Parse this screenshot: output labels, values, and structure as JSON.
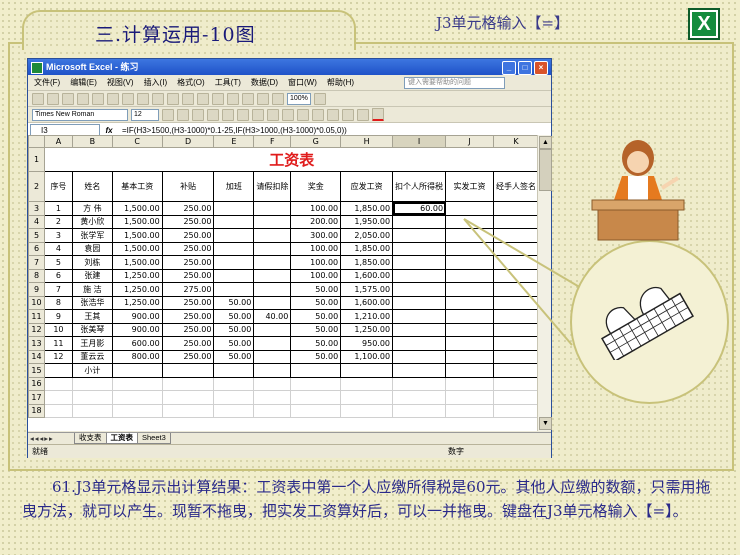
{
  "slide": {
    "tab_title": "三.计算运用-10图",
    "hint": "J3单元格输入【=】",
    "logo_letter": "X",
    "caption": "61.J3单元格显示出计算结果：工资表中第一个人应缴所得税是60元。其他人应缴的数额，只需用拖曳方法，就可以产生。现暂不拖曳，把实发工资算好后，可以一并拖曳。键盘在J3单元格输入【=】。"
  },
  "excel": {
    "title": "Microsoft Excel - 练习",
    "menu": [
      "文件(F)",
      "编辑(E)",
      "视图(V)",
      "插入(I)",
      "格式(O)",
      "工具(T)",
      "数据(D)",
      "窗口(W)",
      "帮助(H)"
    ],
    "help_placeholder": "键入需要帮助的问题",
    "font_name": "Times New Roman",
    "font_size": "12",
    "zoom": "100%",
    "name_box": "I3",
    "fx": "fx",
    "formula": "=IF(H3>1500,(H3-1000)*0.1-25,IF(H3>1000,(H3-1000)*0.05,0))",
    "columns": [
      "A",
      "B",
      "C",
      "D",
      "E",
      "F",
      "G",
      "H",
      "I",
      "J",
      "K"
    ],
    "sheet_title": "工资表",
    "headers": [
      "序号",
      "姓名",
      "基本工资",
      "补贴",
      "加班",
      "请假扣除",
      "奖金",
      "应发工资",
      "扣个人所得税",
      "实发工资",
      "经手人签名"
    ],
    "rows": [
      [
        "1",
        "方 伟",
        "1,500.00",
        "250.00",
        "",
        "",
        "100.00",
        "1,850.00",
        "60.00",
        "",
        ""
      ],
      [
        "2",
        "黄小欣",
        "1,500.00",
        "250.00",
        "",
        "",
        "200.00",
        "1,950.00",
        "",
        "",
        ""
      ],
      [
        "3",
        "张学军",
        "1,500.00",
        "250.00",
        "",
        "",
        "300.00",
        "2,050.00",
        "",
        "",
        ""
      ],
      [
        "4",
        "袁园",
        "1,500.00",
        "250.00",
        "",
        "",
        "100.00",
        "1,850.00",
        "",
        "",
        ""
      ],
      [
        "5",
        "刘栋",
        "1,500.00",
        "250.00",
        "",
        "",
        "100.00",
        "1,850.00",
        "",
        "",
        ""
      ],
      [
        "6",
        "张建",
        "1,250.00",
        "250.00",
        "",
        "",
        "100.00",
        "1,600.00",
        "",
        "",
        ""
      ],
      [
        "7",
        "施 洁",
        "1,250.00",
        "275.00",
        "",
        "",
        "50.00",
        "1,575.00",
        "",
        "",
        ""
      ],
      [
        "8",
        "张浩华",
        "1,250.00",
        "250.00",
        "50.00",
        "",
        "50.00",
        "1,600.00",
        "",
        "",
        ""
      ],
      [
        "9",
        "王其",
        "900.00",
        "250.00",
        "50.00",
        "40.00",
        "50.00",
        "1,210.00",
        "",
        "",
        ""
      ],
      [
        "10",
        "张美琴",
        "900.00",
        "250.00",
        "50.00",
        "",
        "50.00",
        "1,250.00",
        "",
        "",
        ""
      ],
      [
        "11",
        "王月影",
        "600.00",
        "250.00",
        "50.00",
        "",
        "50.00",
        "950.00",
        "",
        "",
        ""
      ],
      [
        "12",
        "董云云",
        "800.00",
        "250.00",
        "50.00",
        "",
        "50.00",
        "1,100.00",
        "",
        "",
        ""
      ]
    ],
    "subtotal_label": "小计",
    "sheet_tabs": [
      "收支表",
      "工资表",
      "Sheet3"
    ],
    "status_left": "就绪",
    "status_right": "数字"
  }
}
